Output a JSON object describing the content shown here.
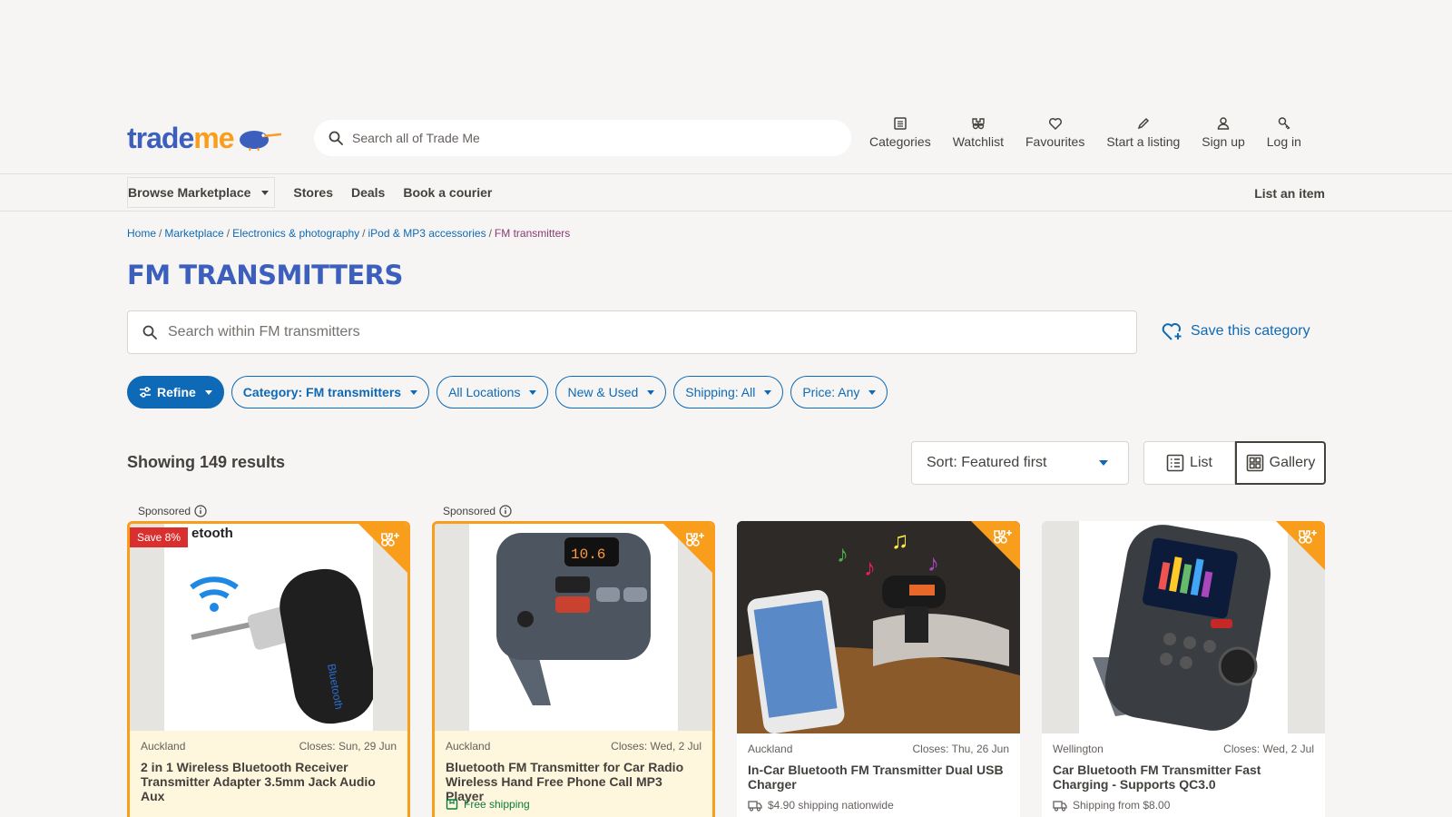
{
  "header": {
    "logo_trade": "trade",
    "logo_me": "me",
    "search_placeholder": "Search all of Trade Me",
    "nav": [
      {
        "label": "Categories",
        "icon": "list-icon"
      },
      {
        "label": "Watchlist",
        "icon": "binoculars-icon"
      },
      {
        "label": "Favourites",
        "icon": "heart-icon"
      },
      {
        "label": "Start a listing",
        "icon": "pencil-icon"
      },
      {
        "label": "Sign up",
        "icon": "person-icon"
      },
      {
        "label": "Log in",
        "icon": "key-icon"
      }
    ]
  },
  "subnav": {
    "browse": "Browse Marketplace",
    "links": [
      "Stores",
      "Deals",
      "Book a courier"
    ],
    "list_item": "List an item"
  },
  "breadcrumb": {
    "items": [
      "Home",
      "Marketplace",
      "Electronics & photography",
      "iPod & MP3 accessories"
    ],
    "current": "FM transmitters"
  },
  "page_title": "FM TRANSMITTERS",
  "category_search_placeholder": "Search within FM transmitters",
  "save_category": "Save this category",
  "filters": {
    "refine": "Refine",
    "category": "Category: FM transmitters",
    "locations": "All Locations",
    "condition": "New & Used",
    "shipping": "Shipping: All",
    "price": "Price: Any"
  },
  "results": {
    "count_text": "Showing 149 results",
    "sort": "Sort: Featured first",
    "view_list": "List",
    "view_gallery": "Gallery"
  },
  "sponsored_label": "Sponsored",
  "listings": [
    {
      "location": "Auckland",
      "closes": "Closes: Sun, 29 Jun",
      "title": "2 in 1 Wireless Bluetooth Receiver Transmitter Adapter 3.5mm Jack Audio Aux",
      "badge": "Save 8%",
      "brand_text": "etooth",
      "sponsored": true
    },
    {
      "location": "Auckland",
      "closes": "Closes: Wed, 2 Jul",
      "title": "Bluetooth FM Transmitter for Car Radio Wireless Hand Free Phone Call MP3 Player",
      "shipping": "Free shipping",
      "sponsored": true
    },
    {
      "location": "Auckland",
      "closes": "Closes: Thu, 26 Jun",
      "title": "In-Car Bluetooth FM Transmitter Dual USB Charger",
      "shipping": "$4.90 shipping nationwide"
    },
    {
      "location": "Wellington",
      "closes": "Closes: Wed, 2 Jul",
      "title": "Car Bluetooth FM Transmitter Fast Charging - Supports QC3.0",
      "shipping": "Shipping from $8.00"
    }
  ],
  "colors": {
    "brand_blue": "#3c5fbd",
    "brand_orange": "#f99d1c",
    "link_blue": "#0e6ab6",
    "badge_red": "#d9302f"
  }
}
